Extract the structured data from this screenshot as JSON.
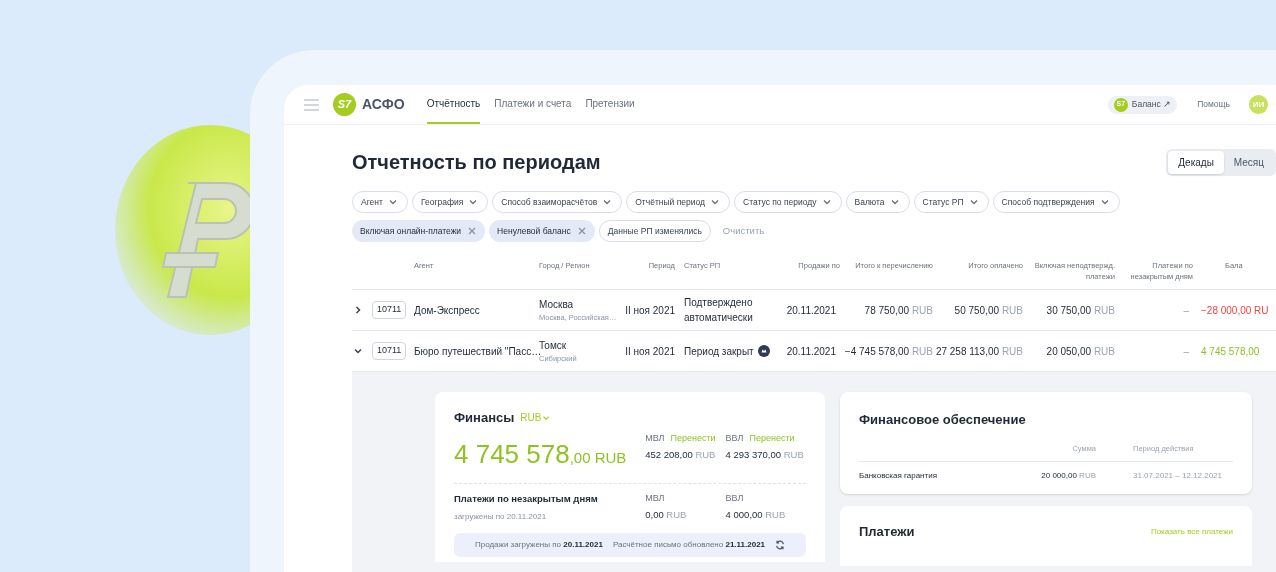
{
  "header": {
    "logo": {
      "badge": "S7",
      "name": "АСФО"
    },
    "nav": [
      {
        "label": "Отчётность",
        "selected": true
      },
      {
        "label": "Платежи и счета",
        "selected": false
      },
      {
        "label": "Претензии",
        "selected": false
      }
    ],
    "balance_button": {
      "badge": "S7",
      "label": "Баланс ↗"
    },
    "help": "Помощь",
    "avatar": "ИИ"
  },
  "page": {
    "title": "Отчетность по периодам",
    "view_toggle": [
      {
        "label": "Декады",
        "selected": true
      },
      {
        "label": "Месяц",
        "selected": false
      }
    ]
  },
  "filters": [
    {
      "label": "Агент",
      "kind": "dropdown"
    },
    {
      "label": "География",
      "kind": "dropdown"
    },
    {
      "label": "Способ взаиморасчётов",
      "kind": "dropdown"
    },
    {
      "label": "Отчётный период",
      "kind": "dropdown"
    },
    {
      "label": "Статус по периоду",
      "kind": "dropdown"
    },
    {
      "label": "Валюта",
      "kind": "dropdown"
    },
    {
      "label": "Статус РП",
      "kind": "dropdown"
    },
    {
      "label": "Способ подтверждения",
      "kind": "dropdown"
    },
    {
      "label": "Включая онлайн-платежи",
      "kind": "removable"
    },
    {
      "label": "Ненулевой баланс",
      "kind": "removable"
    },
    {
      "label": "Данные РП изменялись",
      "kind": "toggle"
    }
  ],
  "clear_filters": "Очистить",
  "table": {
    "columns": [
      "Агент",
      "Город / Регион",
      "Период",
      "Статус РП",
      "Продажи по",
      "Итого к перечислению",
      "Итого оплачено",
      "Включая неподтвержд. платежи",
      "Платежи по незакрытым дням",
      "Бала"
    ],
    "rows": [
      {
        "expanded": false,
        "id": "10711",
        "agent": "Дом-Экспресс",
        "city": "Москва",
        "region": "Москва, Российская…",
        "period": "II ноя 2021",
        "status": "Подтверждено автоматически",
        "status_icon": false,
        "sales": "20.11.2021",
        "total": {
          "amount": "78 750,00",
          "currency": "RUB"
        },
        "paid": {
          "amount": "50 750,00",
          "currency": "RUB"
        },
        "unconfirmed": {
          "amount": "30 750,00",
          "currency": "RUB"
        },
        "unclosed": "–",
        "balance": {
          "amount": "−28 000,00",
          "currency": "RU",
          "color": "#f04444"
        }
      },
      {
        "expanded": true,
        "id": "10711",
        "agent": "Бюро путешествий \"Пасс…",
        "city": "Томск",
        "region": "Сибирский",
        "period": "II ноя 2021",
        "status": "Период закрыт",
        "status_icon": true,
        "sales": "20.11.2021",
        "total": {
          "amount": "−4 745 578,00",
          "currency": "RUB"
        },
        "paid": {
          "amount": "27 258 113,00",
          "currency": "RUB"
        },
        "unconfirmed": {
          "amount": "20 050,00",
          "currency": "RUB"
        },
        "unclosed": "–",
        "balance": {
          "amount": "4 745 578,00",
          "color": "#8ec21f"
        }
      }
    ]
  },
  "finance": {
    "title": "Финансы",
    "currency": "RUB",
    "total_whole": "4 745 578",
    "total_fraction": ",00 RUB",
    "top": [
      {
        "label": "МВЛ",
        "action": "Перенести",
        "amount": "452 208,00",
        "currency": "RUB"
      },
      {
        "label": "ВВЛ",
        "action": "Перенести",
        "amount": "4 293 370,00",
        "currency": "RUB"
      }
    ],
    "unclosed_title": "Платежи по незакрытым дням",
    "unclosed_note": "загружены по 20.11.2021",
    "bottom": [
      {
        "label": "МВЛ",
        "amount": "0,00",
        "currency": "RUB"
      },
      {
        "label": "ВВЛ",
        "amount": "4 000,00",
        "currency": "RUB"
      }
    ],
    "footer": [
      "Продажи загружены по **20.11.2021**",
      "Расчётное письмо обновлено **21.11.2021**"
    ]
  },
  "security": {
    "title": "Финансовое обеспечение",
    "columns": [
      "Сумма",
      "Период действия"
    ],
    "rows": [
      {
        "name": "Банковская гарантия",
        "amount": "20 000,00",
        "currency": "RUB",
        "period": "31.07.2021 – 12.12.2021"
      }
    ]
  },
  "payments": {
    "title": "Платежи",
    "link": "Показать все платежи"
  }
}
